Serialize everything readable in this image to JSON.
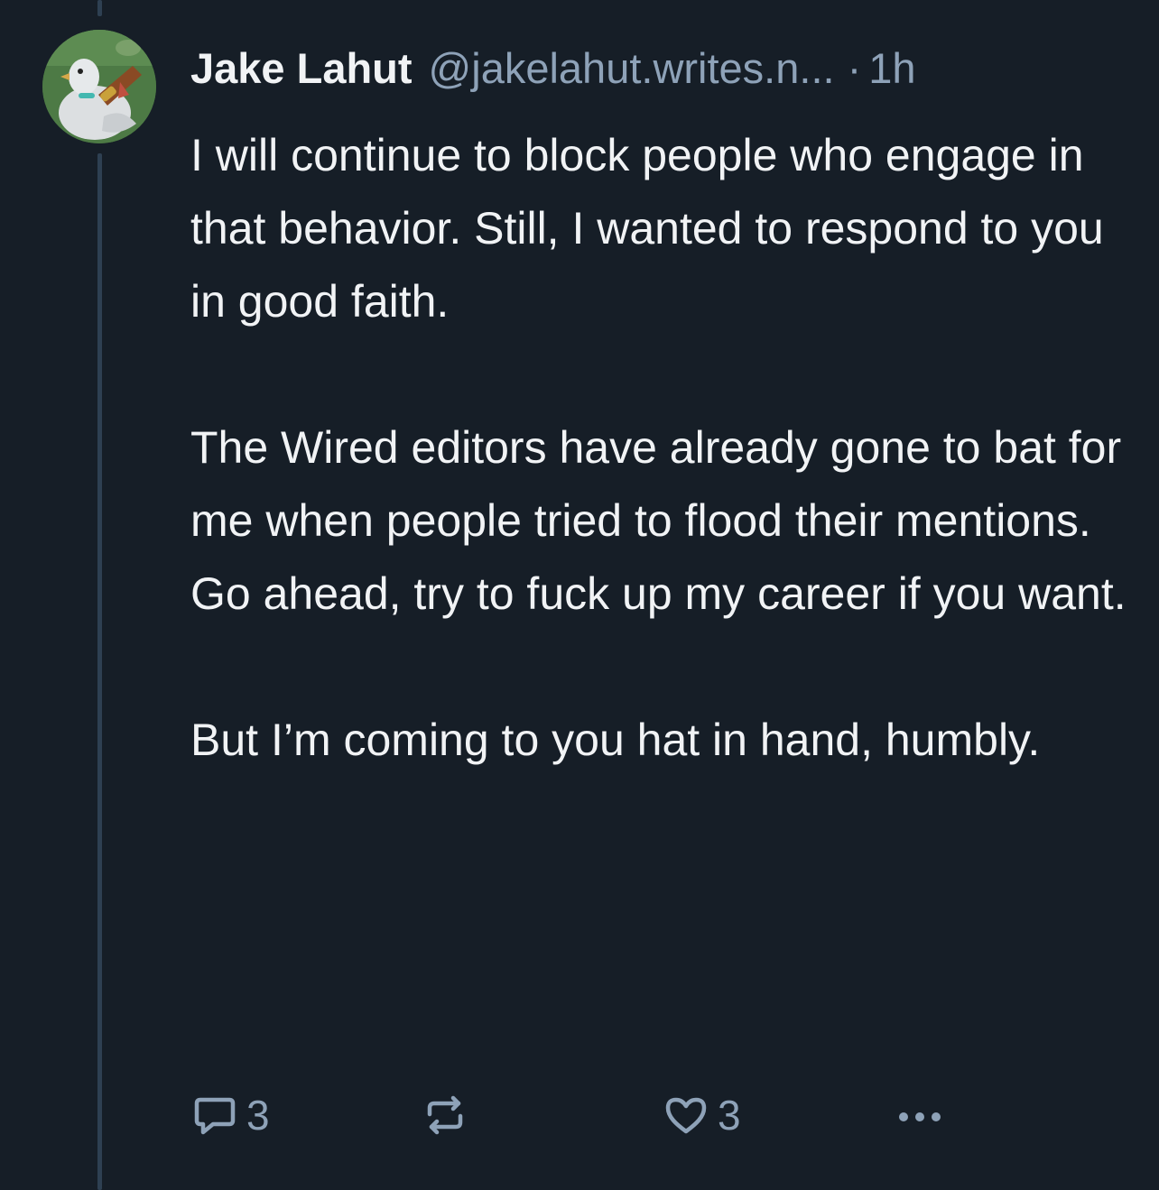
{
  "post": {
    "author": {
      "display_name": "Jake Lahut",
      "handle": "@jakelahut.writes.n...",
      "avatar_icon": "pigeon-with-cigar-avatar"
    },
    "separator": "·",
    "timestamp": "1h",
    "paragraphs": [
      "I will continue to block people who engage in that behavior. Still, I wanted to respond to you in good faith.",
      "The Wired editors have already gone to bat for me when people tried to flood their mentions. Go ahead, try to fuck up my career if you want.",
      "But I’m coming to you hat in hand, humbly."
    ],
    "actions": {
      "reply_icon": "speech-bubble-icon",
      "reply_count": "3",
      "repost_icon": "repost-arrows-icon",
      "like_icon": "heart-icon",
      "like_count": "3",
      "more_icon": "ellipsis-icon"
    }
  },
  "colors": {
    "background": "#161e27",
    "text_primary": "#f1f3f5",
    "text_secondary": "#8ea2b8",
    "thread_line": "#2e4052"
  }
}
